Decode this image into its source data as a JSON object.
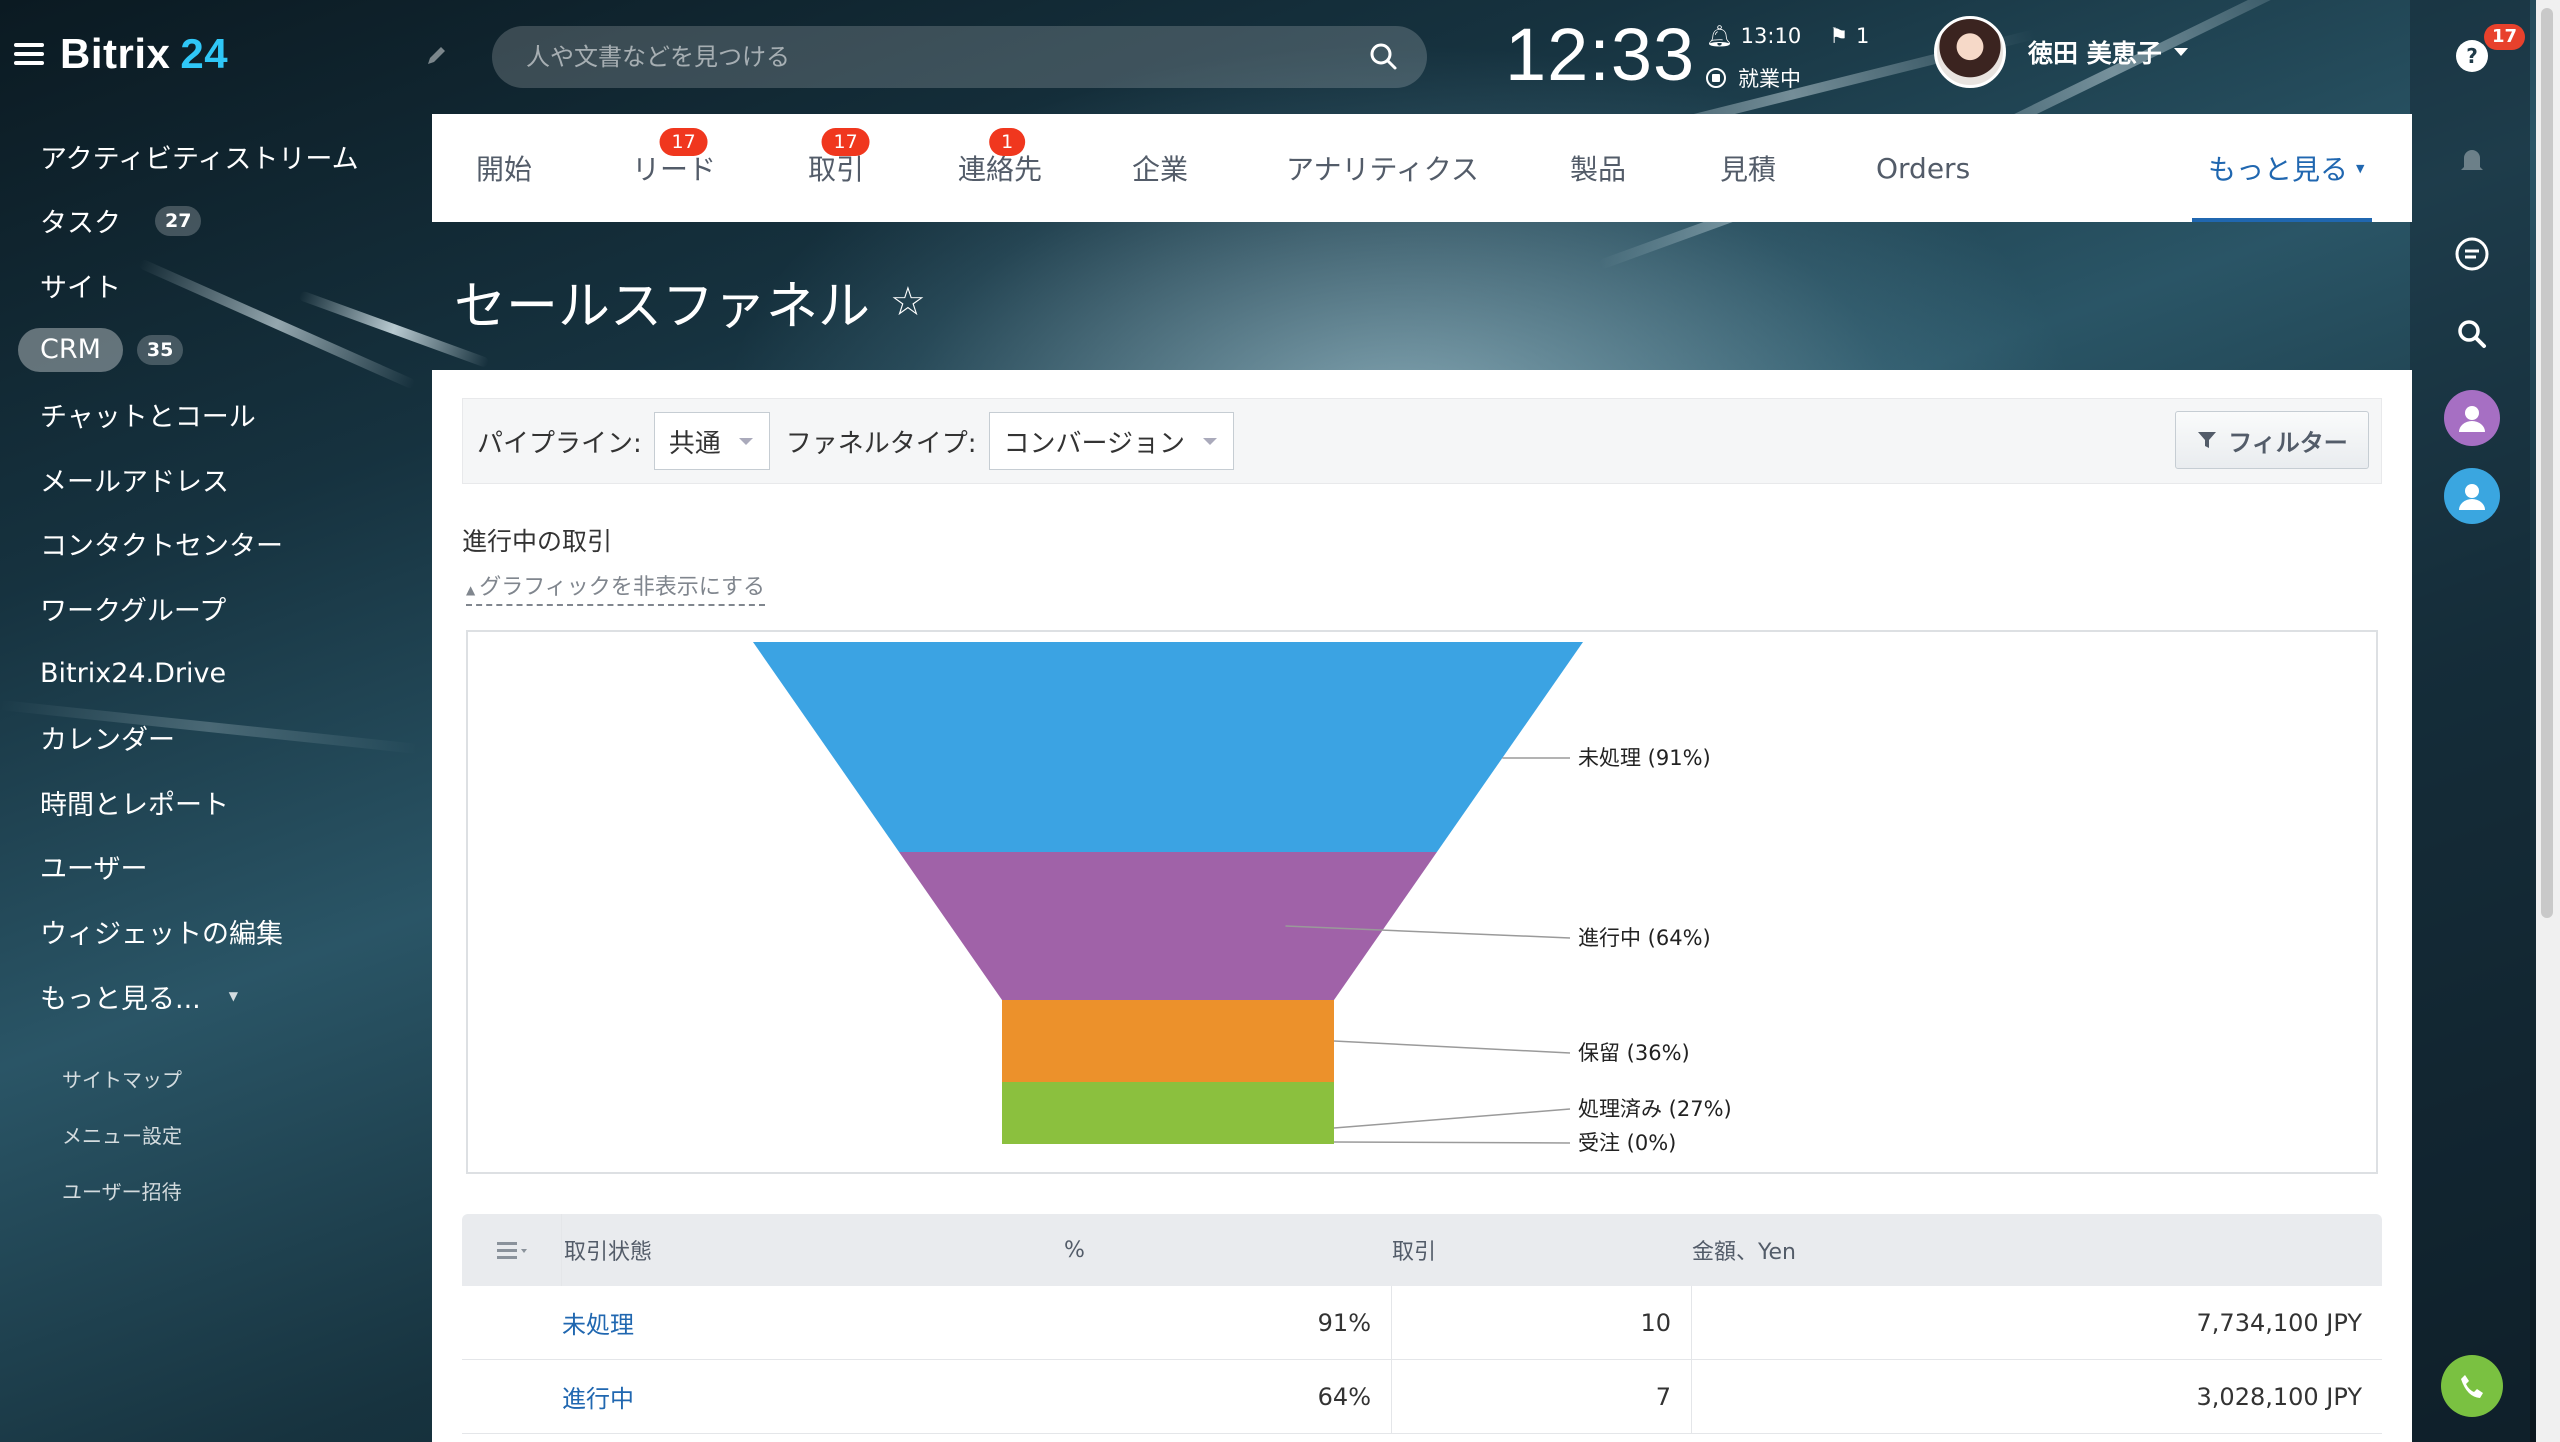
{
  "app": {
    "name": "Bitrix",
    "version_num": "24"
  },
  "sidebar": {
    "items": [
      {
        "label": "アクティビティストリーム",
        "count": ""
      },
      {
        "label": "タスク",
        "count": "27"
      },
      {
        "label": "サイト",
        "count": ""
      },
      {
        "label": "CRM",
        "count": "35",
        "active": true
      },
      {
        "label": "チャットとコール",
        "count": ""
      },
      {
        "label": "メールアドレス",
        "count": ""
      },
      {
        "label": "コンタクトセンター",
        "count": ""
      },
      {
        "label": "ワークグループ",
        "count": ""
      },
      {
        "label": "Bitrix24.Drive",
        "count": ""
      },
      {
        "label": "カレンダー",
        "count": ""
      },
      {
        "label": "時間とレポート",
        "count": ""
      },
      {
        "label": "ユーザー",
        "count": ""
      },
      {
        "label": "ウィジェットの編集",
        "count": ""
      },
      {
        "label": "もっと見る...",
        "count": ""
      }
    ],
    "links": [
      "サイトマップ",
      "メニュー設定",
      "ユーザー招待"
    ]
  },
  "header": {
    "search_placeholder": "人や文書などを見つける",
    "clock": "12:33",
    "reminder_time": "13:10",
    "flag_count": "1",
    "work_status": "就業中",
    "user_name": "徳田 美恵子"
  },
  "rightbar": {
    "notification_badge": "17"
  },
  "tabs": [
    {
      "label": "開始",
      "badge": ""
    },
    {
      "label": "リード",
      "badge": "17"
    },
    {
      "label": "取引",
      "badge": "17"
    },
    {
      "label": "連絡先",
      "badge": "1"
    },
    {
      "label": "企業",
      "badge": ""
    },
    {
      "label": "アナリティクス",
      "badge": ""
    },
    {
      "label": "製品",
      "badge": ""
    },
    {
      "label": "見積",
      "badge": ""
    },
    {
      "label": "Orders",
      "badge": ""
    },
    {
      "label": "もっと見る",
      "badge": ""
    }
  ],
  "page": {
    "title": "セールスファネル"
  },
  "filters": {
    "pipeline_label": "パイプライン:",
    "pipeline_value": "共通",
    "funnel_type_label": "ファネルタイプ:",
    "funnel_type_value": "コンバージョン",
    "filter_button": "フィルター"
  },
  "section": {
    "heading": "進行中の取引",
    "toggle": "グラフィックを非表示にする"
  },
  "chart_data": {
    "type": "funnel",
    "stages": [
      {
        "label": "未処理 (91%)",
        "value": 91,
        "color": "#3ba3e3"
      },
      {
        "label": "進行中 (64%)",
        "value": 64,
        "color": "#a062a8"
      },
      {
        "label": "保留 (36%)",
        "value": 36,
        "color": "#ec912b"
      },
      {
        "label": "処理済み (27%)",
        "value": 27,
        "color": "#8bc03e"
      },
      {
        "label": "受注 (0%)",
        "value": 0,
        "color": "#8bc03e"
      }
    ]
  },
  "table": {
    "headers": [
      "取引状態",
      "%",
      "取引",
      "金額、Yen"
    ],
    "rows": [
      {
        "status": "未処理",
        "percent": "91%",
        "deals": "10",
        "amount": "7,734,100 JPY"
      },
      {
        "status": "進行中",
        "percent": "64%",
        "deals": "7",
        "amount": "3,028,100 JPY"
      }
    ]
  }
}
